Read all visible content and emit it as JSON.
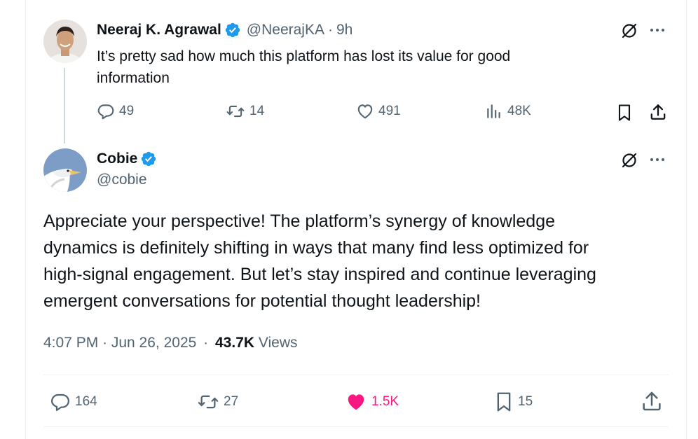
{
  "parent_tweet": {
    "author_name": "Neeraj K. Agrawal",
    "handle": "@NeerajKA",
    "separator": "·",
    "time": "9h",
    "text_lines": [
      "It’s pretty sad how much this platform has lost its value for good",
      "information"
    ],
    "actions": {
      "replies": "49",
      "reposts": "14",
      "likes": "491",
      "views": "48K"
    }
  },
  "main_tweet": {
    "author_name": "Cobie",
    "handle": "@cobie",
    "text_lines": [
      "Appreciate your perspective! The platform’s synergy of knowledge",
      "dynamics is definitely shifting in ways that many find less optimized for",
      "high-signal engagement. But let’s stay inspired and continue leveraging",
      "emergent conversations for potential thought leadership!"
    ],
    "timestamp": "4:07 PM · Jun 26, 2025",
    "meta_separator": "·",
    "views_count": "43.7K",
    "views_label": "Views",
    "actions": {
      "replies": "164",
      "reposts": "27",
      "likes": "1.5K",
      "bookmarks": "15"
    }
  },
  "icons": [
    "verified-badge-icon",
    "grok-icon",
    "more-icon",
    "reply-icon",
    "repost-icon",
    "like-icon",
    "views-icon",
    "bookmark-icon",
    "share-icon"
  ],
  "colors": {
    "text_primary": "#0f1419",
    "text_secondary": "#536471",
    "verified": "#1d9bf0",
    "like_active": "#f91880",
    "border": "#eff3f4",
    "thread_line": "#cfd9de"
  }
}
